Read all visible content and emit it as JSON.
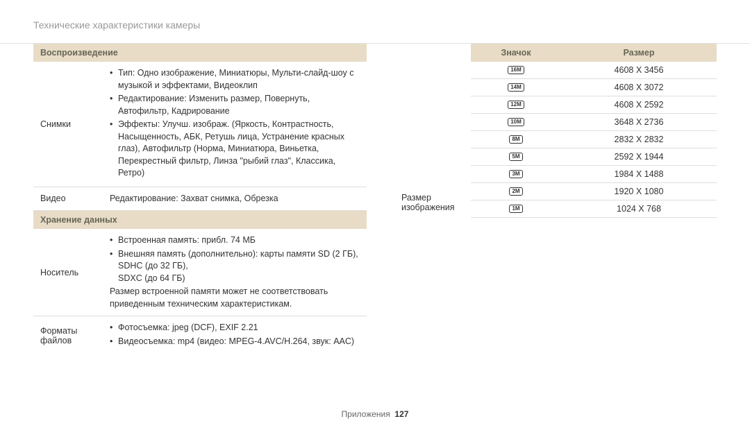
{
  "page_title": "Технические характеристики камеры",
  "left": {
    "section1_header": "Воспроизведение",
    "row1_label": "Снимки",
    "row1_bullets": [
      "Тип: Одно изображение, Миниатюры, Мульти-слайд-шоу с музыкой и эффектами, Видеоклип",
      "Редактирование: Изменить размер, Повернуть, Автофильтр, Кадрирование",
      "Эффекты: Улучш. изображ. (Яркость, Контрастность, Насыщенность, АБК, Ретушь лица, Устранение красных глаз), Автофильтр (Норма, Миниатюра, Виньетка, Перекрестный фильтр, Линза \"рыбий глаз\", Классика, Ретро)"
    ],
    "row2_label": "Видео",
    "row2_value": "Редактирование: Захват снимка, Обрезка",
    "section2_header": "Хранение данных",
    "row3_label": "Носитель",
    "row3_bullets": [
      "Встроенная память: прибл. 74 МБ",
      "Внешняя память (дополнительно): карты памяти SD (2 ГБ),\nSDHC (до 32 ГБ),\nSDXC (до 64 ГБ)"
    ],
    "row3_note": "Размер встроенной памяти может не соответствовать приведенным техническим характеристикам.",
    "row4_label": "Форматы файлов",
    "row4_bullets": [
      "Фотосъемка: jpeg (DCF), EXIF 2.21",
      "Видеосъемка: mp4 (видео: MPEG-4.AVC/H.264, звук: AAC)"
    ]
  },
  "right": {
    "side_label": "Размер изображения",
    "header_icon": "Значок",
    "header_size": "Размер",
    "rows": [
      {
        "icon": "16M",
        "size": "4608 X 3456"
      },
      {
        "icon": "14M",
        "size": "4608 X 3072"
      },
      {
        "icon": "12M",
        "size": "4608 X 2592"
      },
      {
        "icon": "10M",
        "size": "3648 X 2736"
      },
      {
        "icon": "8M",
        "size": "2832 X 2832"
      },
      {
        "icon": "5M",
        "size": "2592 X 1944"
      },
      {
        "icon": "3M",
        "size": "1984 X 1488"
      },
      {
        "icon": "2M",
        "size": "1920 X 1080"
      },
      {
        "icon": "1M",
        "size": "1024 X 768"
      }
    ]
  },
  "footer_label": "Приложения",
  "footer_page": "127"
}
